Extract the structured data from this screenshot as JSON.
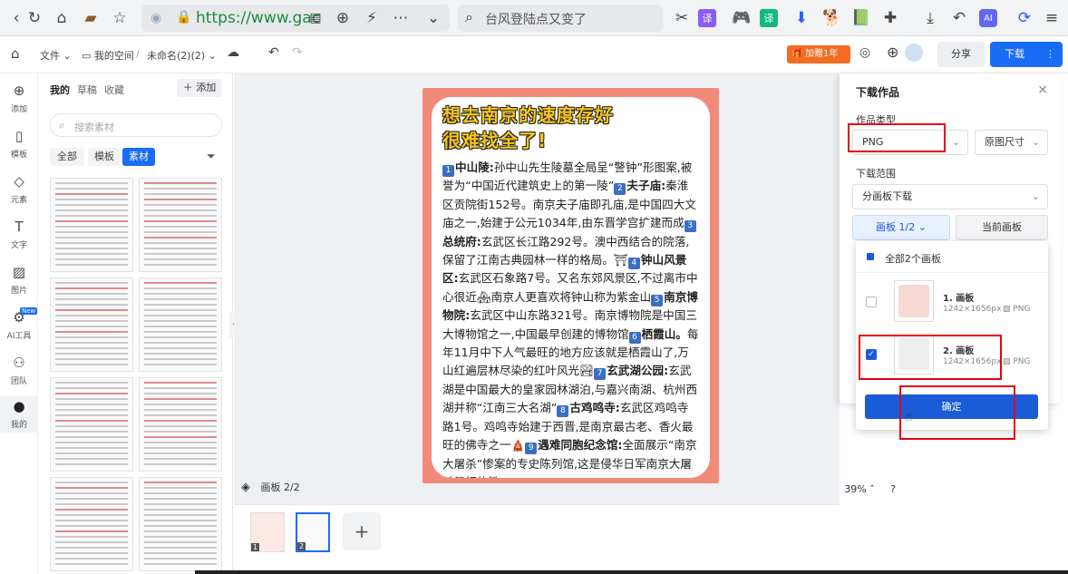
{
  "browser": {
    "url": "https://www.gac",
    "search_text": "台风登陆点又变了",
    "ext_labels": [
      "译",
      "译",
      "AI"
    ]
  },
  "header": {
    "file_menu": "文件",
    "breadcrumb_space": "我的空间",
    "doc_name": "未命名(2)(2)",
    "vip_label": "加赠1年",
    "share_label": "分享",
    "download_label": "下载"
  },
  "rail": {
    "items": [
      "添加",
      "模板",
      "元素",
      "文字",
      "图片",
      "AI工具",
      "团队",
      "我的"
    ],
    "ai_badge": "New"
  },
  "assets": {
    "tabs": [
      "我的",
      "草稿",
      "收藏"
    ],
    "add_label": "添加",
    "search_placeholder": "搜索素材",
    "filters": [
      "全部",
      "模板",
      "素材"
    ]
  },
  "poster": {
    "title_line1": "想去南京的速度存好",
    "title_line2": "很难找全了!",
    "items": [
      {
        "n": "1",
        "name": "中山陵:",
        "text": "孙中山先生陵墓全局呈“警钟”形图案,被誉为“中国近代建筑史上的第一陵”"
      },
      {
        "n": "2",
        "name": "夫子庙:",
        "text": "秦淮区贡院街152号。南京夫子庙即孔庙,是中国四大文庙之一,始建于公元1034年,由东晋学宫扩建而成"
      },
      {
        "n": "3",
        "name": "总统府:",
        "text": "玄武区长江路292号。澳中西结合的院落,保留了江南古典园林一样的格局。⛩"
      },
      {
        "n": "4",
        "name": "钟山风景区:",
        "text": "玄武区石象路7号。又名东郊风景区,不过离市中心很近🏘南京人更喜欢将钟山称为紫金山"
      },
      {
        "n": "5",
        "name": "南京博物院:",
        "text": "玄武区中山东路321号。南京博物院是中国三大博物馆之一,中国最早创建的博物馆"
      },
      {
        "n": "6",
        "name": "栖霞山。",
        "text": "每年11月中下人气最旺的地方应该就是栖霞山了,万山红遍层林尽染的红叶风光🏞"
      },
      {
        "n": "7",
        "name": "玄武湖公园:",
        "text": "玄武湖是中国最大的皇家园林湖泊,与嘉兴南湖、杭州西湖并称“江南三大名湖”"
      },
      {
        "n": "8",
        "name": "古鸡鸣寺:",
        "text": "玄武区鸡鸣寺路1号。鸡鸣寺始建于西晋,是南京最古老、香火最旺的佛寺之一🛕"
      },
      {
        "n": "9",
        "name": "遇难同胞纪念馆:",
        "text": "全面展示“南京大屠杀”惨案的专史陈列馆,这是侵华日军南京大屠杀暴行的铁"
      }
    ]
  },
  "canvas_ctl": {
    "layer_label": "画板 2/2",
    "zoom": "39%",
    "help": "?",
    "page_nums": [
      "1",
      "2"
    ]
  },
  "download": {
    "title": "下载作品",
    "type_label": "作品类型",
    "type_value": "PNG",
    "size_value": "原图尺寸",
    "range_label": "下载范围",
    "range_value": "分画板下载",
    "board_btn": "画板 1/2",
    "current_btn": "当前画板",
    "all_boards": "全部2个画板",
    "boards": [
      {
        "name": "1. 画板",
        "dims": "1242×1656px",
        "fmt": "PNG",
        "checked": false
      },
      {
        "name": "2. 画板",
        "dims": "1242×1656px",
        "fmt": "PNG",
        "checked": true
      }
    ],
    "confirm": "确定"
  },
  "colors": {
    "accent": "#1a5bd8",
    "highlight": "#e60012",
    "poster_bg": "#f28a7a",
    "title_yellow": "#f7c41a"
  }
}
